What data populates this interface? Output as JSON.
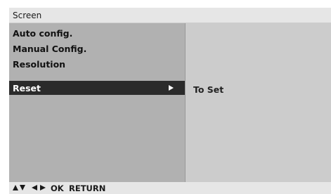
{
  "header": {
    "title": "Screen"
  },
  "menu": {
    "items": [
      {
        "label": "Auto config.",
        "selected": false
      },
      {
        "label": "Manual Config.",
        "selected": false
      },
      {
        "label": "Resolution",
        "selected": false
      },
      {
        "label": "Reset",
        "selected": true
      }
    ]
  },
  "submenu": {
    "value": "To Set"
  },
  "footer": {
    "nav_icons": [
      "up-arrow-icon",
      "down-arrow-icon",
      "left-arrow-icon",
      "right-arrow-icon"
    ],
    "ok_label": "OK",
    "return_label": "RETURN"
  },
  "colors": {
    "header_bg": "#e6e6e6",
    "menu_bg": "#b1b1b1",
    "submenu_bg": "#cccccc",
    "selected_bg": "#2b2b2b",
    "selected_text": "#ffffff"
  }
}
